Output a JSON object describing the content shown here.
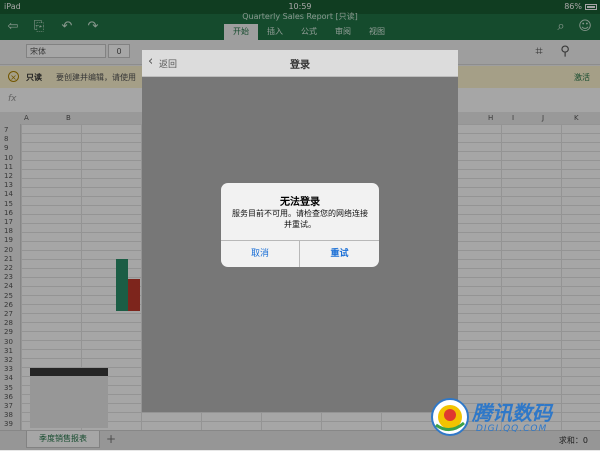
{
  "status_bar": {
    "device": "iPad",
    "time": "10:59",
    "battery": "86%"
  },
  "header": {
    "doc_title": "Quarterly Sales Report [只读]",
    "tabs": [
      "开始",
      "插入",
      "公式",
      "审阅",
      "视图"
    ],
    "active_tab": 0
  },
  "toolbar": {
    "font_name": "宋体",
    "font_size": "0"
  },
  "info_bar": {
    "badge": "只读",
    "message": "要创建并编辑，请使用",
    "action": "激活"
  },
  "sheet": {
    "columns": [
      "A",
      "B",
      "H",
      "I",
      "J",
      "K"
    ],
    "rows": [
      "7",
      "8",
      "9",
      "10",
      "11",
      "12",
      "13",
      "14",
      "15",
      "16",
      "17",
      "18",
      "19",
      "20",
      "21",
      "22",
      "23",
      "24",
      "25",
      "26",
      "27",
      "28",
      "29",
      "30",
      "31",
      "32",
      "33",
      "34",
      "35",
      "36",
      "37",
      "38",
      "39"
    ]
  },
  "sheet_tabs": {
    "name": "季度销售报表",
    "add": "+",
    "sum_label": "求和：0"
  },
  "login_dialog": {
    "back_label": "返回",
    "title": "登录"
  },
  "alert": {
    "title": "无法登录",
    "message": "服务目前不可用。请检查您的网络连接并重试。",
    "cancel": "取消",
    "retry": "重试"
  },
  "watermark": {
    "text": "腾讯数码",
    "url": "DIGI.QQ.COM"
  },
  "colors": {
    "accent": "#217346",
    "alert_button": "#1a6fd6"
  }
}
